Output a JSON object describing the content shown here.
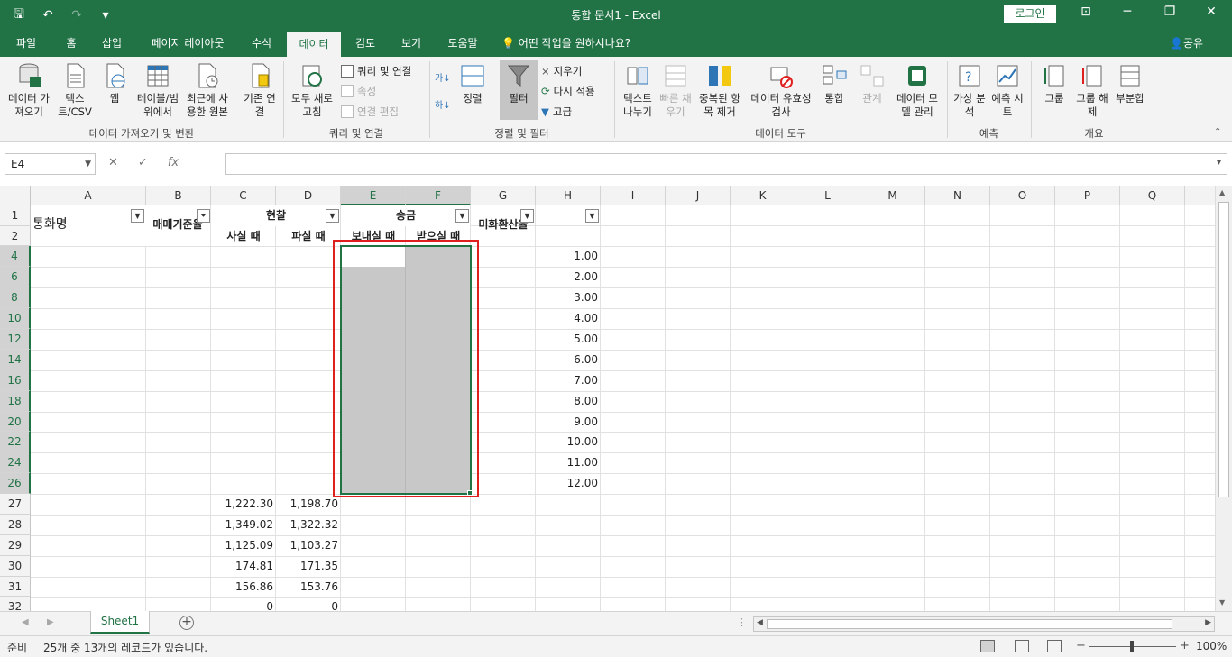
{
  "app": {
    "title": "통합 문서1  -  Excel",
    "login_label": "로그인"
  },
  "qat": {
    "save_icon": "save-icon",
    "undo_icon": "undo-icon",
    "redo_icon": "redo-icon",
    "customize_icon": "chevron-down-icon"
  },
  "tabs": [
    "파일",
    "홈",
    "삽입",
    "페이지 레이아웃",
    "수식",
    "데이터",
    "검토",
    "보기",
    "도움말"
  ],
  "active_tab": "데이터",
  "tell_me": "어떤 작업을 원하시나요?",
  "share_label": "공유",
  "ribbon": {
    "get_data": "데이터 가져오기",
    "text_csv": "텍스트/CSV",
    "web": "웹",
    "from_table": "테이블/범위에서",
    "recent_sources": "최근에 사용한 원본",
    "existing_connections": "기존 연결",
    "group_get_transform": "데이터 가져오기 및 변환",
    "refresh_all": "모두 새로 고침",
    "queries_connections": "쿼리 및 연결",
    "properties": "속성",
    "edit_links": "연결 편집",
    "group_queries": "쿼리 및 연결",
    "sort_az": "가나",
    "sort_za": "하가",
    "sort": "정렬",
    "filter": "필터",
    "clear": "지우기",
    "reapply": "다시 적용",
    "advanced": "고급",
    "group_sort_filter": "정렬 및 필터",
    "text_to_columns": "텍스트 나누기",
    "flash_fill": "빠른 채우기",
    "remove_duplicates": "중복된 항목 제거",
    "data_validation": "데이터 유효성 검사",
    "consolidate": "통합",
    "relationships": "관계",
    "data_model": "데이터 모델 관리",
    "group_data_tools": "데이터 도구",
    "what_if": "가상 분석",
    "forecast_sheet": "예측 시트",
    "group_forecast": "예측",
    "group": "그룹",
    "ungroup": "그룹 해제",
    "subtotal": "부분합",
    "group_outline": "개요"
  },
  "namebox": "E4",
  "formula_value": "",
  "columns": [
    "A",
    "B",
    "C",
    "D",
    "E",
    "F",
    "G",
    "H",
    "I",
    "J",
    "K",
    "L",
    "M",
    "N",
    "O",
    "P",
    "Q"
  ],
  "rows": [
    "1",
    "2",
    "4",
    "6",
    "8",
    "10",
    "12",
    "14",
    "16",
    "18",
    "20",
    "22",
    "24",
    "26",
    "27",
    "28",
    "29",
    "30",
    "31",
    "32"
  ],
  "header_cells": {
    "a1": "통화명",
    "b1": "매매기준율",
    "cd1": "현찰",
    "c2": "사실 때",
    "d2": "파실 때",
    "ef1": "송금",
    "e2": "보내실 때",
    "f2": "받으실 때",
    "g1": "미화환산율"
  },
  "h_values": [
    "1.00",
    "2.00",
    "3.00",
    "4.00",
    "5.00",
    "6.00",
    "7.00",
    "8.00",
    "9.00",
    "10.00",
    "11.00",
    "12.00"
  ],
  "c_values": [
    "1,222.30",
    "1,349.02",
    "1,125.09",
    "174.81",
    "156.86",
    "0"
  ],
  "d_values": [
    "1,198.70",
    "1,322.32",
    "1,103.27",
    "171.35",
    "153.76",
    "0"
  ],
  "sheet_tab": "Sheet1",
  "status": {
    "ready": "준비",
    "message": "25개 중 13개의 레코드가 있습니다.",
    "zoom": "100%"
  }
}
